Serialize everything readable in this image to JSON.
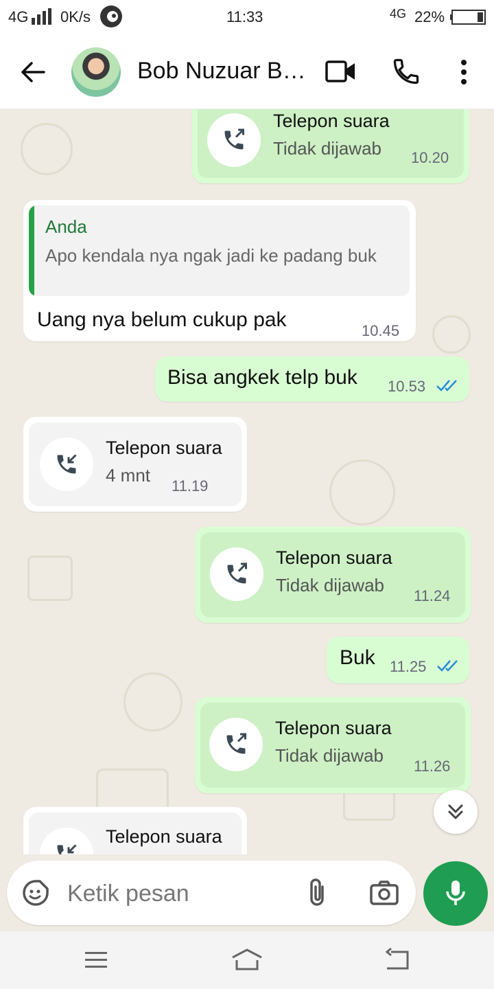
{
  "status_bar": {
    "network_left": "4G",
    "speed": "0K/s",
    "time": "11:33",
    "network_right": "4G",
    "battery": "22%"
  },
  "header": {
    "contact_name": "Bob Nuzuar B…",
    "icons": [
      "back-arrow-icon",
      "video-call-icon",
      "voice-call-icon",
      "more-options-icon"
    ]
  },
  "messages": {
    "m1": {
      "title": "Telepon suara",
      "subtitle": "Tidak dijawab",
      "time": "10.20"
    },
    "m2": {
      "quote_author": "Anda",
      "quote_text": "Apo kendala nya ngak jadi ke padang buk",
      "text": "Uang nya belum cukup pak",
      "time": "10.45"
    },
    "m3": {
      "text": "Bisa angkek telp buk",
      "time": "10.53"
    },
    "m4": {
      "title": "Telepon suara",
      "subtitle": "4 mnt",
      "time": "11.19"
    },
    "m5": {
      "title": "Telepon suara",
      "subtitle": "Tidak dijawab",
      "time": "11.24"
    },
    "m6": {
      "text": "Buk",
      "time": "11.25"
    },
    "m7": {
      "title": "Telepon suara",
      "subtitle": "Tidak dijawab",
      "time": "11.26"
    },
    "m8": {
      "title": "Telepon suara"
    }
  },
  "input": {
    "placeholder": "Ketik pesan"
  },
  "colors": {
    "outgoing_bubble": "#d9fdd3",
    "incoming_bubble": "#ffffff",
    "accent_green": "#1f9d52",
    "read_ticks": "#2a8bd8",
    "chat_background": "#efeae2"
  }
}
